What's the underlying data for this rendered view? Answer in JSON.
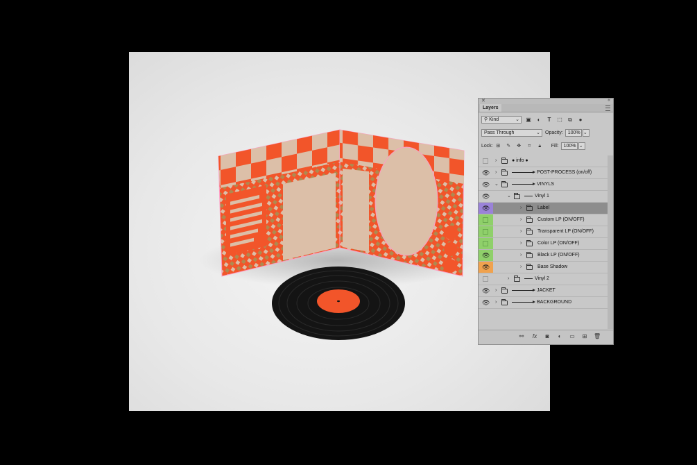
{
  "panel": {
    "tab_label": "Layers",
    "kind_filter": "Kind",
    "blend_mode": "Pass Through",
    "opacity_label": "Opacity:",
    "opacity_value": "100%",
    "lock_label": "Lock:",
    "fill_label": "Fill:",
    "fill_value": "100%"
  },
  "layers": [
    {
      "name": "● info ●",
      "visible": false,
      "color": "",
      "indent": 0,
      "open": false,
      "style": "plain"
    },
    {
      "name": "POST-PROCESS (on/off)",
      "visible": true,
      "color": "",
      "indent": 0,
      "open": false,
      "style": "arrow"
    },
    {
      "name": "VINYLS",
      "visible": true,
      "color": "",
      "indent": 0,
      "open": true,
      "style": "arrow"
    },
    {
      "name": "Vinyl 1",
      "visible": true,
      "color": "",
      "indent": 1,
      "open": true,
      "style": "line"
    },
    {
      "name": "Label",
      "visible": true,
      "color": "#9a82d8",
      "indent": 2,
      "open": false,
      "style": "plain",
      "active": true
    },
    {
      "name": "Custom LP (ON/OFF)",
      "visible": false,
      "color": "#8fd06a",
      "indent": 2,
      "open": false,
      "style": "plain"
    },
    {
      "name": "Transparent LP (ON/OFF)",
      "visible": false,
      "color": "#8fd06a",
      "indent": 2,
      "open": false,
      "style": "plain"
    },
    {
      "name": "Color LP (ON/OFF)",
      "visible": false,
      "color": "#8fd06a",
      "indent": 2,
      "open": false,
      "style": "plain"
    },
    {
      "name": "Black LP (ON/OFF)",
      "visible": true,
      "color": "#8fd06a",
      "indent": 2,
      "open": false,
      "style": "plain"
    },
    {
      "name": "Base Shadow",
      "visible": true,
      "color": "#f0a24e",
      "indent": 2,
      "open": false,
      "style": "plain"
    },
    {
      "name": "Vinyl 2",
      "visible": false,
      "color": "",
      "indent": 1,
      "open": false,
      "style": "line"
    },
    {
      "name": "JACKET",
      "visible": true,
      "color": "",
      "indent": 0,
      "open": false,
      "style": "arrow"
    },
    {
      "name": "BACKGROUND",
      "visible": true,
      "color": "",
      "indent": 0,
      "open": false,
      "style": "arrow"
    }
  ],
  "colors": {
    "accent_orange": "#f2552a",
    "tile_beige": "#dcbfa8",
    "stripe_olive": "#b0894f",
    "vinyl_black": "#141414",
    "glow_pink": "#ff9cc4"
  },
  "icons": {
    "filter": [
      "image-filter-icon",
      "adjustment-filter-icon",
      "type-filter-icon",
      "shape-filter-icon",
      "smart-object-filter-icon",
      "filter-toggle-icon"
    ],
    "lock": [
      "lock-transparent-icon",
      "lock-pixels-icon",
      "lock-position-icon",
      "lock-artboard-icon",
      "lock-all-icon"
    ],
    "bottom": [
      "link-icon",
      "fx-icon",
      "mask-icon",
      "adjustment-icon",
      "new-group-icon",
      "new-layer-icon",
      "trash-icon"
    ]
  }
}
